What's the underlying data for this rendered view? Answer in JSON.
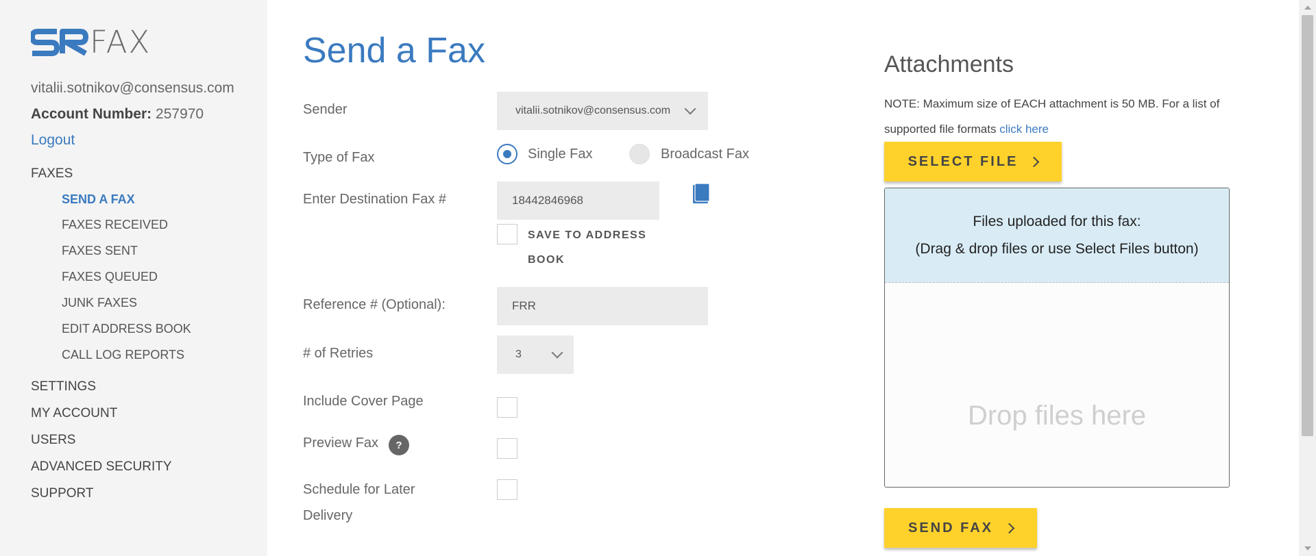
{
  "brand": {
    "logo_text": "FAX"
  },
  "sidebar": {
    "email": "vitalii.sotnikov@consensus.com",
    "account_label": "Account Number:",
    "account_number": "257970",
    "logout": "Logout",
    "faxes_section": "FAXES",
    "faxes_items": [
      "SEND A FAX",
      "FAXES RECEIVED",
      "FAXES SENT",
      "FAXES QUEUED",
      "JUNK FAXES",
      "EDIT ADDRESS BOOK",
      "CALL LOG REPORTS"
    ],
    "sections": [
      "SETTINGS",
      "MY ACCOUNT",
      "USERS",
      "ADVANCED SECURITY",
      "SUPPORT"
    ]
  },
  "form": {
    "title": "Send a Fax",
    "sender_label": "Sender",
    "sender_value": "vitalii.sotnikov@consensus.com",
    "type_label": "Type of Fax",
    "type_single": "Single Fax",
    "type_broadcast": "Broadcast Fax",
    "destination_label": "Enter Destination Fax #",
    "destination_value": "18442846968",
    "save_to_address_book": "SAVE TO ADDRESS BOOK",
    "reference_label": "Reference # (Optional):",
    "reference_value": "FRR",
    "retries_label": "# of Retries",
    "retries_value": "3",
    "cover_label": "Include Cover Page",
    "preview_label": "Preview Fax",
    "preview_help": "?",
    "schedule_label_line1": "Schedule for Later",
    "schedule_label_line2": "Delivery"
  },
  "attachments": {
    "title": "Attachments",
    "note_text": "NOTE: Maximum size of EACH attachment is 50 MB. For a list of supported file formats ",
    "note_link": "click here",
    "select_button": "SELECT FILE",
    "uploaded_line1": "Files uploaded for this fax:",
    "uploaded_line2": "(Drag & drop files or use Select Files button)",
    "drop_text": "Drop files here",
    "send_button": "SEND FAX"
  },
  "colors": {
    "accent": "#3a7abf",
    "button": "#fed22b",
    "dropzone_header": "#d9ecf6",
    "sidebar_bg": "#f4f4f4"
  }
}
